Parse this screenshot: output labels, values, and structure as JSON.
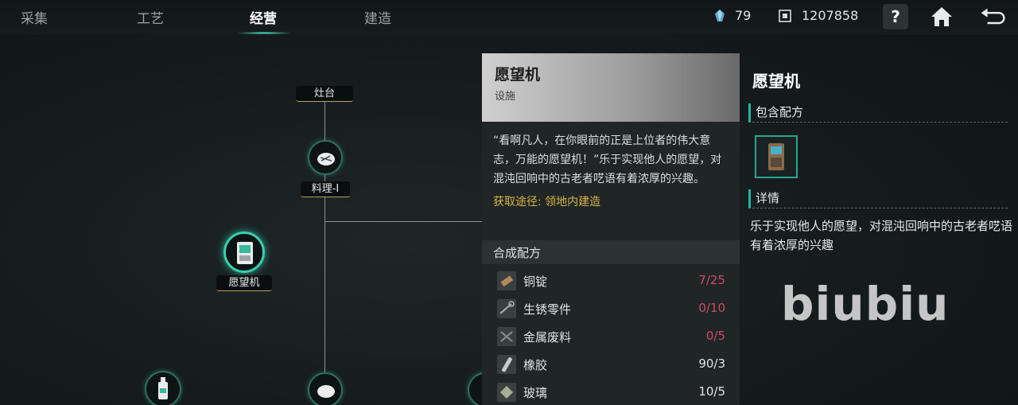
{
  "tabs": [
    {
      "label": "采集"
    },
    {
      "label": "工艺"
    },
    {
      "label": "经营"
    },
    {
      "label": "建造"
    }
  ],
  "resources": {
    "crystal_count": "79",
    "currency_count": "1207858"
  },
  "buttons": {
    "help_label": "?"
  },
  "tree": {
    "node_stove": "灶台",
    "node_cooking": "料理-I",
    "node_wishing_machine": "愿望机"
  },
  "detail_panel": {
    "title": "愿望机",
    "subtitle": "设施",
    "description": "“看啊凡人，在你眼前的正是上位者的伟大意志，万能的愿望机！”乐于实现他人的愿望，对混沌回响中的古老者呓语有着浓厚的兴趣。",
    "source": "获取途径: 领地内建造",
    "recipe_header": "合成配方",
    "materials": [
      {
        "name": "铜锭",
        "count": "7/25",
        "color": "#d04a6a"
      },
      {
        "name": "生锈零件",
        "count": "0/10",
        "color": "#d04a6a"
      },
      {
        "name": "金属废料",
        "count": "0/5",
        "color": "#d04a6a"
      },
      {
        "name": "橡胶",
        "count": "90/3",
        "color": "#e0e3e3"
      },
      {
        "name": "玻璃",
        "count": "10/5",
        "color": "#e0e3e3"
      }
    ]
  },
  "side_panel": {
    "title": "愿望机",
    "contains_recipe_label": "包含配方",
    "details_label": "详情",
    "details_text": "乐于实现他人的愿望，对混沌回响中的古老者呓语有着浓厚的兴趣"
  },
  "watermark": "biubiu",
  "colors": {
    "accent": "#1fb79a",
    "source_text": "#d6b546",
    "insufficient": "#d04a6a"
  }
}
